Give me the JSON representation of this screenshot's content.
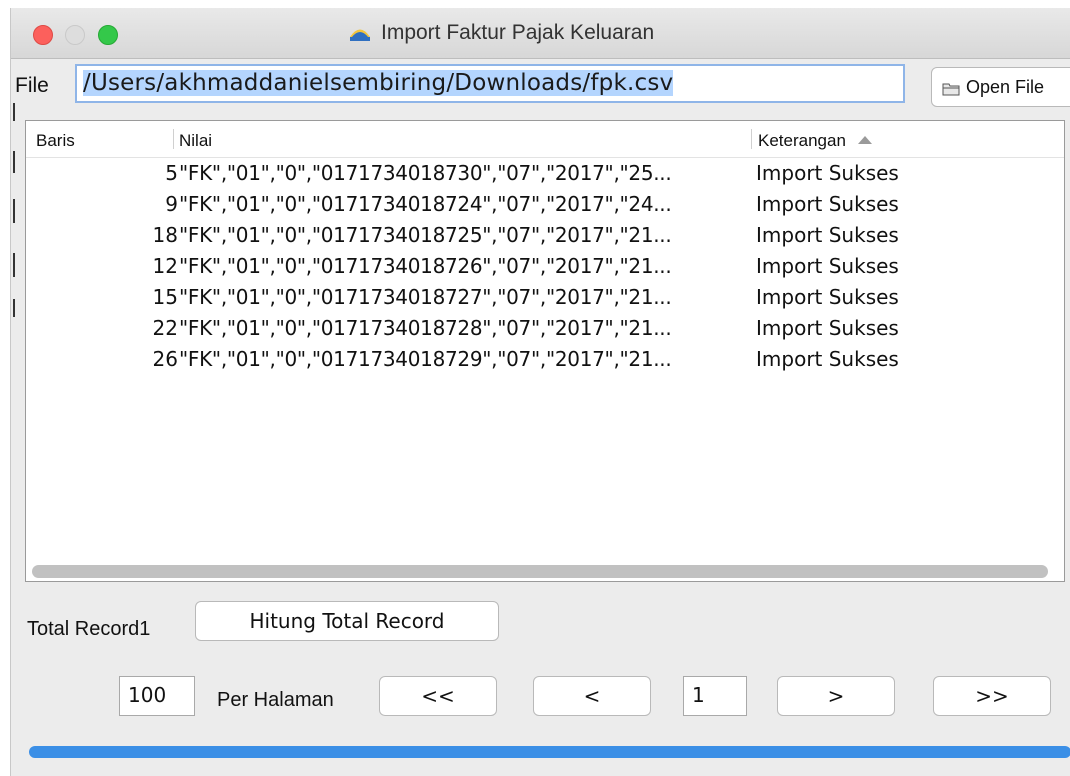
{
  "window": {
    "title": "Import Faktur Pajak Keluaran"
  },
  "file": {
    "label": "File",
    "path": "/Users/akhmaddanielsembiring/Downloads/fpk.csv",
    "open_button": "Open File"
  },
  "table": {
    "columns": [
      "Baris",
      "Nilai",
      "Keterangan"
    ],
    "sorted_column": "Keterangan",
    "rows": [
      {
        "baris": "5",
        "nilai": "\"FK\",\"01\",\"0\",\"0171734018730\",\"07\",\"2017\",\"25...",
        "keterangan": "Import Sukses"
      },
      {
        "baris": "9",
        "nilai": "\"FK\",\"01\",\"0\",\"0171734018724\",\"07\",\"2017\",\"24...",
        "keterangan": "Import Sukses"
      },
      {
        "baris": "18",
        "nilai": "\"FK\",\"01\",\"0\",\"0171734018725\",\"07\",\"2017\",\"21...",
        "keterangan": "Import Sukses"
      },
      {
        "baris": "12",
        "nilai": "\"FK\",\"01\",\"0\",\"0171734018726\",\"07\",\"2017\",\"21...",
        "keterangan": "Import Sukses"
      },
      {
        "baris": "15",
        "nilai": "\"FK\",\"01\",\"0\",\"0171734018727\",\"07\",\"2017\",\"21...",
        "keterangan": "Import Sukses"
      },
      {
        "baris": "22",
        "nilai": "\"FK\",\"01\",\"0\",\"0171734018728\",\"07\",\"2017\",\"21...",
        "keterangan": "Import Sukses"
      },
      {
        "baris": "26",
        "nilai": "\"FK\",\"01\",\"0\",\"0171734018729\",\"07\",\"2017\",\"21...",
        "keterangan": "Import Sukses"
      }
    ]
  },
  "total_record": {
    "label": "Total Record",
    "value": "1",
    "button": "Hitung Total Record"
  },
  "pagination": {
    "per_page_value": "100",
    "per_page_label": "Per Halaman",
    "first": "<<",
    "prev": "<",
    "page_value": "1",
    "next": ">",
    "last": ">>"
  },
  "colors": {
    "selection": "#b4d5fe",
    "progress": "#3b8fe6",
    "close": "#fc605c",
    "maximize": "#34c84a"
  }
}
